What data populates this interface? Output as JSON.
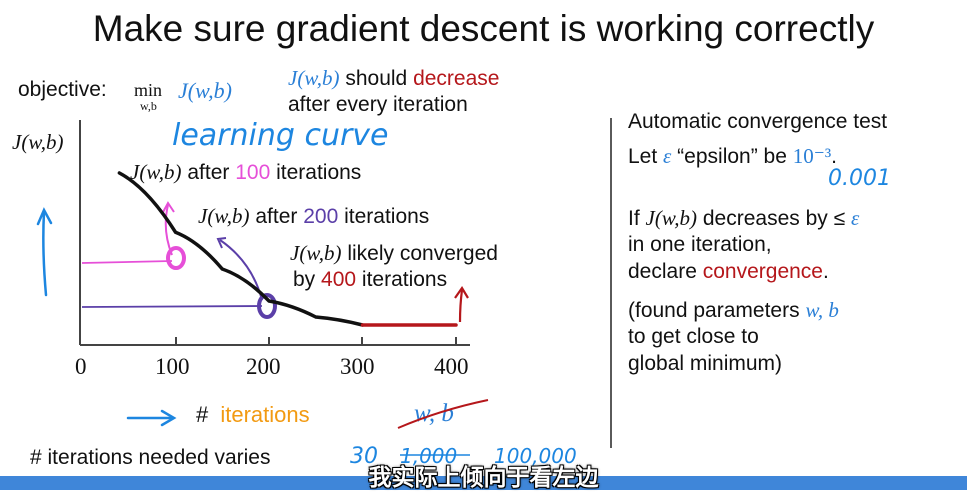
{
  "slide": {
    "title": "Make sure gradient descent is working correctly",
    "objective": {
      "label": "objective:",
      "min": "min",
      "sub": "w,b",
      "expr": "J(w,b)"
    },
    "note": {
      "prefix": "J(w,b)",
      "should": " should ",
      "decrease": "decrease",
      "line2": "after every iteration"
    },
    "learning_curve_label": "learning curve",
    "annotations": {
      "a100": {
        "prefix": "J(w,b)",
        "after": " after ",
        "num": "100",
        "rest": " iterations"
      },
      "a200": {
        "prefix": "J(w,b)",
        "after": " after ",
        "num": "200",
        "rest": " iterations"
      },
      "a400": {
        "prefix": "J(w,b)",
        "rest": " likely converged",
        "by": "by ",
        "num": "400",
        "rest2": " iterations"
      }
    },
    "xlabel": {
      "hash": "#",
      "word": "iterations"
    },
    "crossed_params": "w, b",
    "varies": {
      "label": "# iterations needed varies",
      "examples": [
        "30",
        "1,000",
        "100,000"
      ]
    },
    "right": {
      "heading": "Automatic convergence test",
      "let": "Let",
      "epsilon_sym": "ε",
      "epsilon_word": "“epsilon” be",
      "epsilon_val": "10⁻³",
      "epsilon_period": ".",
      "epsilon_hand": "0.001",
      "if": "If",
      "j": "J(w,b)",
      "decreases": "decreases by ≤",
      "eps": "ε",
      "line2": "in one iteration,",
      "declare": "declare",
      "convergence": "convergence",
      "dot": ".",
      "found1": "(found parameters",
      "wb": "w, b",
      "found2": "to get close to",
      "found3": "global minimum)"
    }
  },
  "subtitle": "我实际上倾向于看左边",
  "colors": {
    "blue": "#2a7fd6",
    "red": "#b5171b",
    "pink": "#e64fd8",
    "purple": "#5b3fa8",
    "orange": "#f29a12"
  },
  "chart_data": {
    "type": "line",
    "title": "",
    "xlabel": "# iterations",
    "ylabel": "J(w,b)",
    "x_ticks": [
      0,
      100,
      200,
      300,
      400
    ],
    "xlim": [
      0,
      400
    ],
    "series": [
      {
        "values_x": [
          40,
          100,
          150,
          200,
          250,
          300
        ],
        "values_y": [
          0.95,
          0.58,
          0.35,
          0.15,
          0.05,
          0.0
        ]
      },
      {
        "values_x": [
          300,
          400
        ],
        "values_y": [
          0.0,
          0.0
        ]
      }
    ]
  }
}
